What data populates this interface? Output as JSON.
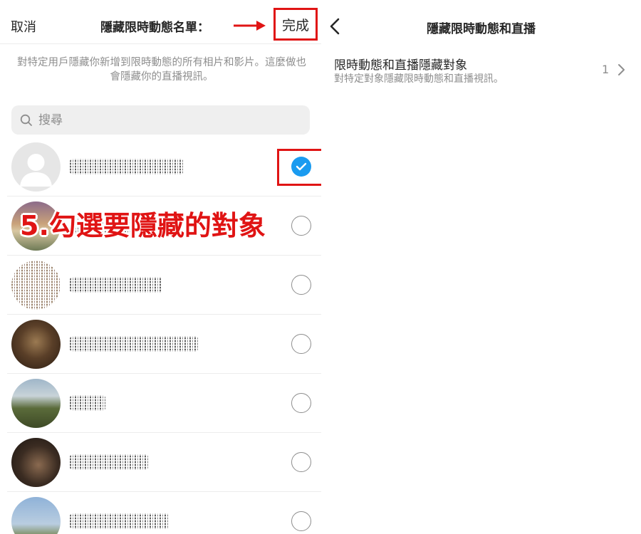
{
  "left_panel": {
    "cancel_label": "取消",
    "title": "隱藏限時動態名單：",
    "done_label": "完成",
    "description": "對特定用戶隱藏你新增到限時動態的所有相片和影片。這麼做也會隱藏你的直播視訊。",
    "search": {
      "placeholder": "搜尋"
    },
    "annotation": "5.勾選要隱藏的對象",
    "users": [
      {
        "checked": true
      },
      {
        "checked": false
      },
      {
        "checked": false
      },
      {
        "checked": false
      },
      {
        "checked": false
      },
      {
        "checked": false
      },
      {
        "checked": false
      }
    ]
  },
  "right_panel": {
    "title": "隱藏限時動態和直播",
    "setting": {
      "label": "限時動態和直播隱藏對象",
      "sublabel": "對特定對象隱藏限時動態和直播視訊。",
      "count": "1"
    }
  },
  "colors": {
    "accent_blue": "#1a9bf0",
    "annotation_red": "#e01414",
    "secondary_text": "#8e8e8e"
  }
}
